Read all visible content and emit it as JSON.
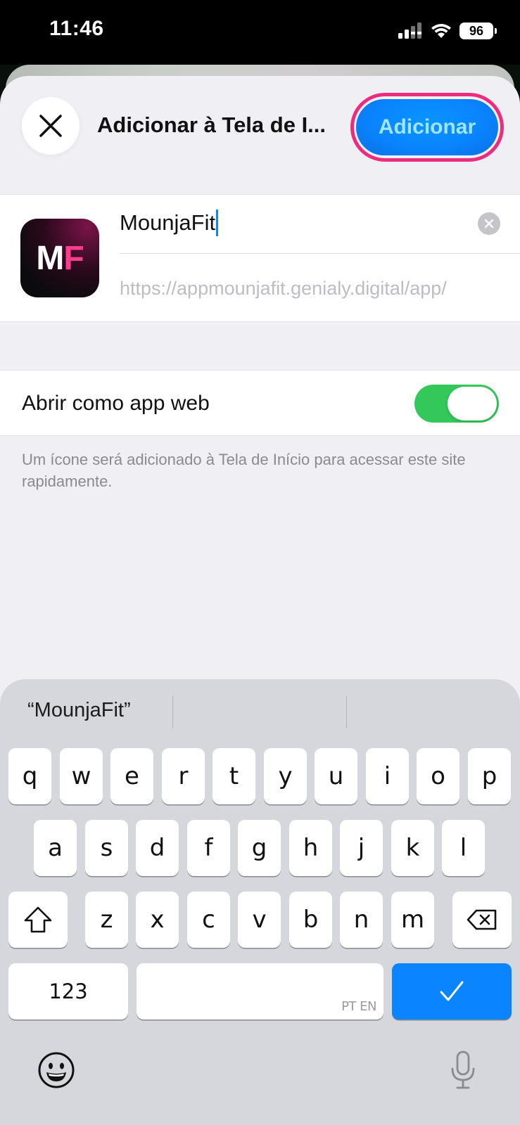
{
  "status_bar": {
    "time": "11:46",
    "battery": "96"
  },
  "sheet": {
    "title": "Adicionar à Tela de I...",
    "add_button": "Adicionar",
    "app_icon": {
      "letter1": "M",
      "letter2": "F"
    },
    "name_value": "MounjaFit",
    "url": "https://appmounjafit.genialy.digital/app/",
    "toggle_label": "Abrir como app web",
    "toggle_on": true,
    "footnote": "Um ícone será adicionado à Tela de Início para acessar este site rapidamente."
  },
  "colors": {
    "accent_blue": "#0a84ff",
    "toggle_green": "#34c759",
    "highlight_ring": "#ee2c7e",
    "app_icon_pink": "#ff3d8e"
  },
  "keyboard": {
    "suggestions": [
      "“MounjaFit”",
      "",
      ""
    ],
    "row1": [
      "q",
      "w",
      "e",
      "r",
      "t",
      "y",
      "u",
      "i",
      "o",
      "p"
    ],
    "row2": [
      "a",
      "s",
      "d",
      "f",
      "g",
      "h",
      "j",
      "k",
      "l"
    ],
    "row3": [
      "z",
      "x",
      "c",
      "v",
      "b",
      "n",
      "m"
    ],
    "numbers_key": "123",
    "space_lang": "PT EN",
    "icons": {
      "shift": "shift-icon",
      "delete": "delete-icon",
      "done": "checkmark-icon",
      "emoji": "emoji-icon",
      "mic": "microphone-icon"
    }
  }
}
